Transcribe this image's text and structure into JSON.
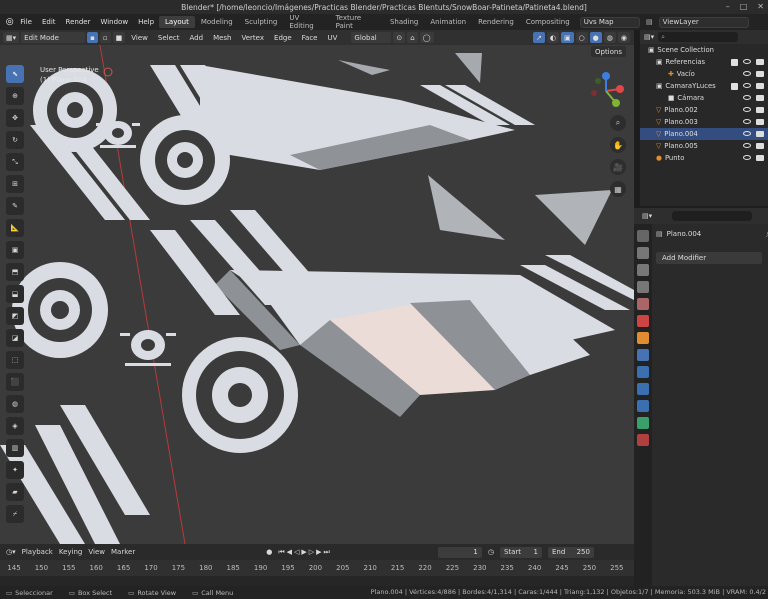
{
  "window": {
    "title": "Blender* [/home/leoncio/Imágenes/Practicas Blender/Practicas Blentuts/SnowBoar-Patineta/Patineta4.blend]"
  },
  "menu": [
    "File",
    "Edit",
    "Render",
    "Window",
    "Help"
  ],
  "workspaces": [
    {
      "label": "Layout",
      "active": true
    },
    {
      "label": "Modeling"
    },
    {
      "label": "Sculpting"
    },
    {
      "label": "UV Editing"
    },
    {
      "label": "Texture Paint"
    },
    {
      "label": "Shading"
    },
    {
      "label": "Animation"
    },
    {
      "label": "Rendering"
    },
    {
      "label": "Compositing"
    }
  ],
  "uvs_map": "Uvs Map",
  "view_layer": "ViewLayer",
  "viewport_header": {
    "mode": "Edit Mode",
    "menus": [
      "View",
      "Select",
      "Add",
      "Mesh",
      "Vertex",
      "Edge",
      "Face",
      "UV"
    ],
    "transform": "Global",
    "xyz": [
      "X",
      "Y",
      "Z"
    ],
    "options": "Options"
  },
  "viewport_overlay": {
    "line1": "User Perspective",
    "line2": "(1) Plano.004"
  },
  "gizmo": {
    "x": "X",
    "y": "Y",
    "z": "Z"
  },
  "outliner": {
    "scene_collection": "Scene Collection",
    "rows": [
      {
        "name": "Referencias",
        "indent": 1,
        "icon": "collection"
      },
      {
        "name": "Vacío",
        "indent": 2,
        "icon": "empty"
      },
      {
        "name": "CamaraYLuces",
        "indent": 1,
        "icon": "collection"
      },
      {
        "name": "Cámara",
        "indent": 2,
        "icon": "camera"
      },
      {
        "name": "Plano.002",
        "indent": 1,
        "icon": "mesh"
      },
      {
        "name": "Plano.003",
        "indent": 1,
        "icon": "mesh"
      },
      {
        "name": "Plano.004",
        "indent": 1,
        "icon": "mesh",
        "selected": true
      },
      {
        "name": "Plano.005",
        "indent": 1,
        "icon": "mesh"
      },
      {
        "name": "Punto",
        "indent": 1,
        "icon": "light"
      }
    ]
  },
  "properties": {
    "object": "Plano.004",
    "add_modifier": "Add Modifier"
  },
  "timeline": {
    "menus": [
      "Playback",
      "Keying",
      "View",
      "Marker"
    ],
    "current": "1",
    "start_label": "Start",
    "start": "1",
    "end_label": "End",
    "end": "250",
    "ticks": [
      "145",
      "150",
      "155",
      "160",
      "165",
      "170",
      "175",
      "180",
      "185",
      "190",
      "195",
      "200",
      "205",
      "210",
      "215",
      "220",
      "225",
      "230",
      "235",
      "240",
      "245",
      "250",
      "255"
    ]
  },
  "status": {
    "select": "Seleccionar",
    "box": "Box Select",
    "rotate": "Rotate View",
    "call": "Call Menu",
    "stats": "Plano.004 | Vértices:4/886 | Bordes:4/1,314 | Caras:1/444 | Triang:1,132 | Objetos:1/7 | Memoria: 503.3 MiB | VRAM: 0.4/2"
  },
  "colors": {
    "accent": "#4772b3",
    "bg": "#3c3c3c",
    "mesh": "#d9dde3",
    "face_dark": "#8e9296",
    "selected_face": "#ecdcd8"
  }
}
